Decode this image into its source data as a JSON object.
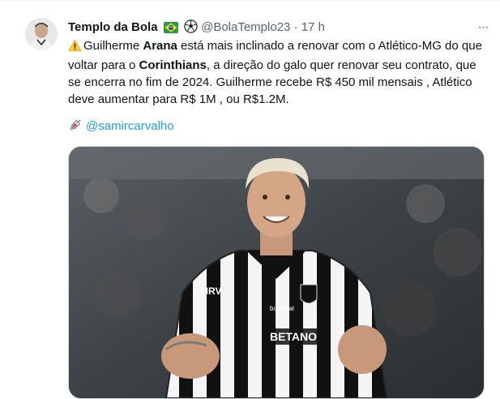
{
  "author": {
    "display_name": "Templo da Bola",
    "emoji_flag": "🇧🇷",
    "emoji_ball": "⚽",
    "handle": "@BolaTemplo23",
    "separator": "·",
    "time": "17 h"
  },
  "more_label": "···",
  "text": {
    "warning_icon": "warning-icon",
    "p1": "Guilherme ",
    "b1": "Arana",
    "p2": " está mais inclinado a renovar com o Atlético-MG do que voltar para o ",
    "b2": "Corinthians",
    "p3": ", a direção do galo quer renovar seu contrato, que se encerra no fim de 2024. Guilherme recebe R$ 450 mil mensais , Atlético deve aumentar para R$ 1M , ou R$1.2M."
  },
  "mention": {
    "icon": "syringe-icon",
    "handle": "@samircarvalho"
  },
  "media": {
    "jersey_sponsor": "BETANO",
    "jersey_brand": "MRV",
    "jersey_sponsor2": "bopvidal"
  },
  "colors": {
    "link": "#1d9bf0",
    "muted": "#536471",
    "text": "#0f1419"
  }
}
